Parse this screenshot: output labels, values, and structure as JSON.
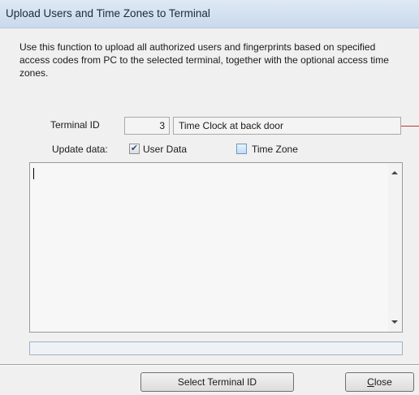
{
  "window": {
    "title": "Upload Users and Time Zones to Terminal"
  },
  "description": "Use this function to upload all authorized users and fingerprints based on specified access codes from PC to the selected terminal, together with the optional access time zones.",
  "terminal": {
    "label": "Terminal ID",
    "id_value": "3",
    "name_value": "Time Clock at back door"
  },
  "update_data": {
    "label": "Update data:",
    "options": [
      {
        "label": "User Data",
        "checked": true
      },
      {
        "label": "Time Zone",
        "checked": false
      }
    ]
  },
  "log": {
    "text": ""
  },
  "progress": {
    "value": 0
  },
  "buttons": {
    "select_terminal": "Select Terminal ID",
    "close_mnemonic": "C",
    "close_rest": "lose"
  }
}
